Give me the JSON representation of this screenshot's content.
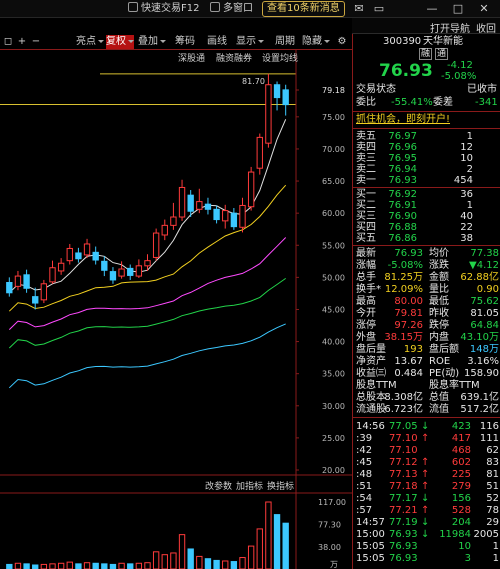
{
  "topbar": {
    "quick_trade": "快速交易F12",
    "multi_window": "多窗口",
    "news": "查看10条新消息",
    "win_icons": [
      "✉",
      "▭",
      "—",
      "□",
      "✕"
    ]
  },
  "right_header": {
    "open_nav": "打开导航",
    "collapse": "收回"
  },
  "toolbar": {
    "items": [
      "◻",
      "+",
      "−",
      "亮点",
      "复权",
      "叠加",
      "筹码",
      "画线",
      "显示",
      "周期",
      "隐藏",
      "⚙"
    ],
    "selected": "复权"
  },
  "chart_labels": {
    "top_tags": [
      "深股通",
      "融资融券",
      "设置均线"
    ],
    "high_marker": "81.70",
    "indicator_tags": [
      "改参数",
      "加指标",
      "换指标"
    ]
  },
  "chart_data": {
    "type": "candlestick",
    "price_axis": [
      "79.18",
      "75.00",
      "70.00",
      "65.00",
      "60.00",
      "55.00",
      "50.00",
      "45.00",
      "40.00",
      "35.00",
      "30.00",
      "25.00",
      "20.00"
    ],
    "current_price_line": 76.93,
    "volume_axis": [
      "117.00",
      "77.30",
      "38.00"
    ],
    "volume_unit": "万",
    "volume_ylim": [
      0,
      117
    ],
    "price_ylim": [
      20,
      79.18
    ],
    "candles": [
      {
        "o": 49.2,
        "c": 47.6,
        "h": 50.0,
        "l": 47.0
      },
      {
        "o": 48.6,
        "c": 50.2,
        "h": 51.0,
        "l": 48.0
      },
      {
        "o": 50.4,
        "c": 48.3,
        "h": 51.2,
        "l": 47.6
      },
      {
        "o": 47.0,
        "c": 46.0,
        "h": 48.4,
        "l": 45.0
      },
      {
        "o": 46.5,
        "c": 49.0,
        "h": 49.6,
        "l": 46.0
      },
      {
        "o": 49.3,
        "c": 51.5,
        "h": 52.6,
        "l": 49.0
      },
      {
        "o": 51.0,
        "c": 52.2,
        "h": 53.0,
        "l": 50.4
      },
      {
        "o": 52.6,
        "c": 54.5,
        "h": 55.2,
        "l": 52.0
      },
      {
        "o": 53.8,
        "c": 52.9,
        "h": 54.6,
        "l": 52.3
      },
      {
        "o": 53.5,
        "c": 55.2,
        "h": 56.0,
        "l": 53.0
      },
      {
        "o": 53.9,
        "c": 52.7,
        "h": 54.8,
        "l": 52.0
      },
      {
        "o": 52.5,
        "c": 51.1,
        "h": 53.3,
        "l": 50.2
      },
      {
        "o": 50.9,
        "c": 49.6,
        "h": 51.6,
        "l": 49.0
      },
      {
        "o": 50.2,
        "c": 51.3,
        "h": 52.5,
        "l": 49.8
      },
      {
        "o": 51.4,
        "c": 50.3,
        "h": 52.0,
        "l": 49.6
      },
      {
        "o": 50.2,
        "c": 51.8,
        "h": 52.8,
        "l": 49.9
      },
      {
        "o": 51.8,
        "c": 52.6,
        "h": 53.6,
        "l": 51.0
      },
      {
        "o": 53.1,
        "c": 56.9,
        "h": 57.6,
        "l": 52.6
      },
      {
        "o": 56.6,
        "c": 58.1,
        "h": 59.0,
        "l": 55.8
      },
      {
        "o": 58.1,
        "c": 59.4,
        "h": 61.6,
        "l": 57.4
      },
      {
        "o": 59.4,
        "c": 64.0,
        "h": 65.2,
        "l": 58.8
      },
      {
        "o": 62.8,
        "c": 60.3,
        "h": 63.6,
        "l": 59.4
      },
      {
        "o": 60.6,
        "c": 61.8,
        "h": 63.8,
        "l": 60.0
      },
      {
        "o": 61.4,
        "c": 60.6,
        "h": 62.4,
        "l": 59.8
      },
      {
        "o": 60.6,
        "c": 59.0,
        "h": 61.2,
        "l": 58.4
      },
      {
        "o": 58.8,
        "c": 60.4,
        "h": 61.3,
        "l": 57.6
      },
      {
        "o": 60.0,
        "c": 57.9,
        "h": 60.8,
        "l": 57.4
      },
      {
        "o": 57.8,
        "c": 61.2,
        "h": 62.4,
        "l": 57.0
      },
      {
        "o": 61.0,
        "c": 66.4,
        "h": 67.2,
        "l": 60.4
      },
      {
        "o": 67.0,
        "c": 71.8,
        "h": 72.4,
        "l": 66.0
      },
      {
        "o": 70.9,
        "c": 80.0,
        "h": 81.7,
        "l": 70.2
      },
      {
        "o": 80.0,
        "c": 78.0,
        "h": 80.5,
        "l": 76.0
      },
      {
        "o": 79.2,
        "c": 76.9,
        "h": 80.0,
        "l": 75.2
      }
    ],
    "volumes": [
      8,
      10,
      9,
      7,
      8,
      9,
      10,
      12,
      9,
      11,
      10,
      9,
      8,
      10,
      9,
      10,
      11,
      30,
      25,
      28,
      60,
      35,
      22,
      18,
      15,
      14,
      13,
      20,
      40,
      70,
      117,
      95,
      80
    ],
    "ma_colors": [
      "#e0e0e0",
      "#f2d020",
      "#ff4aff",
      "#22d34a",
      "#3cc8ff"
    ]
  },
  "quote": {
    "code": "300390",
    "name": "天华新能",
    "badges": [
      "融",
      "通"
    ],
    "price": "76.93",
    "change": "-4.12",
    "change_pct": "-5.08%",
    "trade_status_label": "交易状态",
    "trade_status": "已收市",
    "ratio_label": "委比",
    "ratio": "-55.41%",
    "diff_label": "委差",
    "diff": "-341",
    "banner": "抓住机会，即刻开户!",
    "asks": [
      {
        "label": "卖五",
        "price": "76.97",
        "vol": "1"
      },
      {
        "label": "卖四",
        "price": "76.96",
        "vol": "12"
      },
      {
        "label": "卖三",
        "price": "76.95",
        "vol": "10"
      },
      {
        "label": "卖二",
        "price": "76.94",
        "vol": "2"
      },
      {
        "label": "卖一",
        "price": "76.93",
        "vol": "454"
      }
    ],
    "bids": [
      {
        "label": "买一",
        "price": "76.92",
        "vol": "36"
      },
      {
        "label": "买二",
        "price": "76.91",
        "vol": "1"
      },
      {
        "label": "买三",
        "price": "76.90",
        "vol": "40"
      },
      {
        "label": "买四",
        "price": "76.88",
        "vol": "22"
      },
      {
        "label": "买五",
        "price": "76.86",
        "vol": "38"
      }
    ],
    "stats": [
      [
        {
          "l": "最新",
          "v": "76.93",
          "c": "g"
        },
        {
          "l": "均价",
          "v": "77.38",
          "c": "g"
        }
      ],
      [
        {
          "l": "涨幅",
          "v": "-5.08%",
          "c": "g"
        },
        {
          "l": "涨跌",
          "v": "▼4.12",
          "c": "g"
        }
      ],
      [
        {
          "l": "总手",
          "v": "81.25万",
          "c": "y"
        },
        {
          "l": "金额",
          "v": "62.88亿",
          "c": "y"
        }
      ],
      [
        {
          "l": "换手*",
          "v": "12.09%",
          "c": "y"
        },
        {
          "l": "量比",
          "v": "0.90",
          "c": "y"
        }
      ],
      [
        {
          "l": "最高",
          "v": "80.00",
          "c": "r"
        },
        {
          "l": "最低",
          "v": "75.62",
          "c": "g"
        }
      ],
      [
        {
          "l": "今开",
          "v": "79.81",
          "c": "r"
        },
        {
          "l": "昨收",
          "v": "81.05",
          "c": "w"
        }
      ],
      [
        {
          "l": "涨停",
          "v": "97.26",
          "c": "r"
        },
        {
          "l": "跌停",
          "v": "64.84",
          "c": "g"
        }
      ],
      [
        {
          "l": "外盘",
          "v": "38.15万",
          "c": "r"
        },
        {
          "l": "内盘",
          "v": "43.10万",
          "c": "g"
        }
      ],
      [
        {
          "l": "盘后量",
          "v": "193",
          "c": "y"
        },
        {
          "l": "盘后额",
          "v": "148万",
          "c": "c"
        }
      ],
      [
        {
          "l": "净资产",
          "v": "13.67",
          "c": "w"
        },
        {
          "l": "ROE",
          "v": "3.16%",
          "c": "w"
        }
      ],
      [
        {
          "l": "收益㈢",
          "v": "0.484",
          "c": "w"
        },
        {
          "l": "PE(动)",
          "v": "158.90",
          "c": "w"
        }
      ],
      [
        {
          "l": "股息TTM",
          "v": "",
          "c": "w"
        },
        {
          "l": "股息率TTM",
          "v": "",
          "c": "w"
        }
      ],
      [
        {
          "l": "总股本",
          "v": "8.308亿",
          "c": "w"
        },
        {
          "l": "总值",
          "v": "639.1亿",
          "c": "w"
        }
      ],
      [
        {
          "l": "流通股",
          "v": "6.723亿",
          "c": "w"
        },
        {
          "l": "流值",
          "v": "517.2亿",
          "c": "w"
        }
      ]
    ],
    "ticks": [
      {
        "t": "14:56",
        "p": "77.05",
        "d": "↓",
        "v": "423",
        "n": "116",
        "dc": "g",
        "vc": "g"
      },
      {
        "t": ":39",
        "p": "77.10",
        "d": "↑",
        "v": "417",
        "n": "111",
        "dc": "r",
        "vc": "r"
      },
      {
        "t": ":42",
        "p": "77.10",
        "d": "",
        "v": "468",
        "n": "62",
        "dc": "r",
        "vc": "r"
      },
      {
        "t": ":45",
        "p": "77.12",
        "d": "↑",
        "v": "602",
        "n": "83",
        "dc": "r",
        "vc": "r"
      },
      {
        "t": ":48",
        "p": "77.13",
        "d": "↑",
        "v": "225",
        "n": "81",
        "dc": "r",
        "vc": "r"
      },
      {
        "t": ":51",
        "p": "77.18",
        "d": "↑",
        "v": "279",
        "n": "51",
        "dc": "r",
        "vc": "r"
      },
      {
        "t": ":54",
        "p": "77.17",
        "d": "↓",
        "v": "156",
        "n": "52",
        "dc": "g",
        "vc": "g"
      },
      {
        "t": ":57",
        "p": "77.21",
        "d": "↑",
        "v": "528",
        "n": "78",
        "dc": "r",
        "vc": "r"
      },
      {
        "t": "14:57",
        "p": "77.19",
        "d": "↓",
        "v": "204",
        "n": "29",
        "dc": "g",
        "vc": "g"
      },
      {
        "t": "15:00",
        "p": "76.93",
        "d": "↓",
        "v": "11984",
        "n": "2005",
        "dc": "g",
        "vc": "g"
      },
      {
        "t": "15:05",
        "p": "76.93",
        "d": "",
        "v": "10",
        "n": "1",
        "dc": "g",
        "vc": "g"
      },
      {
        "t": "15:05",
        "p": "76.93",
        "d": "",
        "v": "3",
        "n": "1",
        "dc": "g",
        "vc": "g"
      }
    ]
  }
}
